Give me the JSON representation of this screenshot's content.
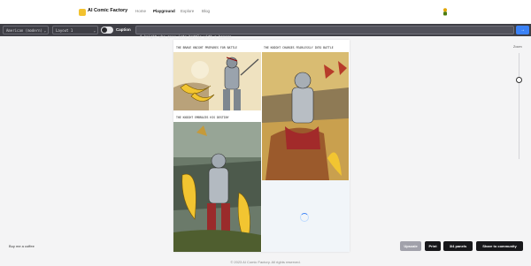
{
  "nav": {
    "brand": "AI Comic Factory",
    "links": [
      "Home",
      "Playground",
      "Explore",
      "Blog"
    ],
    "active_index": 1
  },
  "toolbar": {
    "style_select": "American (modern)",
    "layout_select": "Layout 1",
    "caption_label": "Caption",
    "caption_enabled": true,
    "prompt_value": "A knight who goes into battle with a banana",
    "send_icon": "arrow-right-icon"
  },
  "comic": {
    "panels": [
      {
        "caption": "THE BRAVE KNIGHT PREPARES FOR BATTLE"
      },
      {
        "caption": "THE KNIGHT CHARGES FEARLESSLY INTO BATTLE"
      },
      {
        "caption": "THE KNIGHT EMBRACES HIS DESTINY"
      },
      {
        "caption": ""
      }
    ],
    "loading_panel": 4
  },
  "zoom": {
    "label": "Zoom",
    "level": 0.75
  },
  "bottom": {
    "coffee_link": "Buy me a coffee",
    "upscale": "Upscale",
    "print": "Print",
    "panels": "3/4 panels",
    "share": "Share to community"
  },
  "footer": {
    "text": "© 2023 AI Comic Factory. All rights reserved."
  },
  "colors": {
    "accent": "#3b82f6",
    "toolbar": "#3f3f46",
    "logo": "#f2c230"
  }
}
